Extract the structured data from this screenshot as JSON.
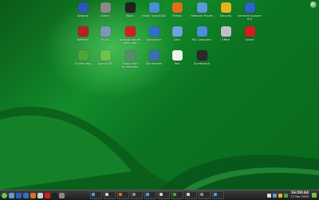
{
  "desktop": {
    "icons": [
      {
        "label": "Amarok",
        "icon": "amarok-icon",
        "color": "#2a57b8"
      },
      {
        "label": "admin",
        "icon": "user-folder-icon",
        "color": "#8a8a8a"
      },
      {
        "label": "Book",
        "icon": "book-icon",
        "color": "#222222"
      },
      {
        "label": "Install OpenSUSE",
        "icon": "installer-icon",
        "color": "#4b8ecf"
      },
      {
        "label": "Firefox",
        "icon": "firefox-icon",
        "color": "#e0701c"
      },
      {
        "label": "Network Places",
        "icon": "network-folder-icon",
        "color": "#5b9bd5"
      },
      {
        "label": "Security",
        "icon": "lock-icon",
        "color": "#e3b51a"
      },
      {
        "label": "Internet Explorer 6.0",
        "icon": "ie-icon",
        "color": "#2a64c7"
      },
      {
        "label": "Kaffeine",
        "icon": "kaffeine-icon",
        "color": "#b32222"
      },
      {
        "label": "KCalc",
        "icon": "calculator-icon",
        "color": "#7e97b6"
      },
      {
        "label": "acrobat reader\nwith read",
        "icon": "pdf-icon",
        "color": "#cc2222"
      },
      {
        "label": "Konqueror",
        "icon": "konqueror-icon",
        "color": "#3070c8"
      },
      {
        "label": "Disk",
        "icon": "disk-icon",
        "color": "#6ca3d8"
      },
      {
        "label": "My Computer",
        "icon": "computer-icon",
        "color": "#4a8fd6"
      },
      {
        "label": "Office",
        "icon": "office-icon",
        "color": "#c0c0c0"
      },
      {
        "label": "Opera",
        "icon": "opera-icon",
        "color": "#d31d1d"
      },
      {
        "label": "Online Help",
        "icon": "help-icon",
        "color": "#4da43a"
      },
      {
        "label": "openSUSE",
        "icon": "opensuse-icon",
        "color": "#6cc24a"
      },
      {
        "label": "Sound and\nmultimedia",
        "icon": "media-icon",
        "color": "#5a8a6a"
      },
      {
        "label": "Documents",
        "icon": "documents-icon",
        "color": "#3a6fb0"
      },
      {
        "label": "Text",
        "icon": "text-file-icon",
        "color": "#f2f2f2"
      },
      {
        "label": "Screenshot",
        "icon": "screenshot-icon",
        "color": "#2a2a2a"
      }
    ]
  },
  "taskbar": {
    "launchers": [
      {
        "icon": "suse-menu-icon",
        "color": "#6cc24a"
      },
      {
        "icon": "home-icon",
        "color": "#5b9bd5"
      },
      {
        "icon": "browser-icon",
        "color": "#2a64c7"
      },
      {
        "icon": "konqueror-icon",
        "color": "#3070c8"
      },
      {
        "icon": "firefox-icon",
        "color": "#e0701c"
      },
      {
        "icon": "mail-icon",
        "color": "#cfcfcf"
      },
      {
        "icon": "opera-icon",
        "color": "#d31d1d"
      },
      {
        "icon": "terminal-icon",
        "color": "#222222"
      },
      {
        "icon": "desktop-icon",
        "color": "#8a8a8a"
      }
    ],
    "tasks": [
      {
        "icon": "task-icon",
        "color": "#5b9bd5"
      },
      {
        "icon": "task-icon",
        "color": "#cfcfcf"
      },
      {
        "icon": "task-icon",
        "color": "#e0701c"
      },
      {
        "icon": "task-icon",
        "color": "#8a8a8a"
      },
      {
        "icon": "task-icon",
        "color": "#5b9bd5"
      },
      {
        "icon": "task-icon",
        "color": "#cfcfcf"
      },
      {
        "icon": "task-icon",
        "color": "#4da43a"
      },
      {
        "icon": "task-icon",
        "color": "#cfcfcf"
      },
      {
        "icon": "task-icon",
        "color": "#8a8a8a"
      },
      {
        "icon": "task-icon",
        "color": "#5b9bd5"
      }
    ],
    "tray": [
      {
        "icon": "volume-icon",
        "color": "#dddddd"
      },
      {
        "icon": "network-icon",
        "color": "#5b9bd5"
      },
      {
        "icon": "update-icon",
        "color": "#e3b51a"
      },
      {
        "icon": "battery-icon",
        "color": "#4da43a"
      }
    ],
    "clock": {
      "time": "16:50:44",
      "date": "27 Dec 2009"
    }
  }
}
